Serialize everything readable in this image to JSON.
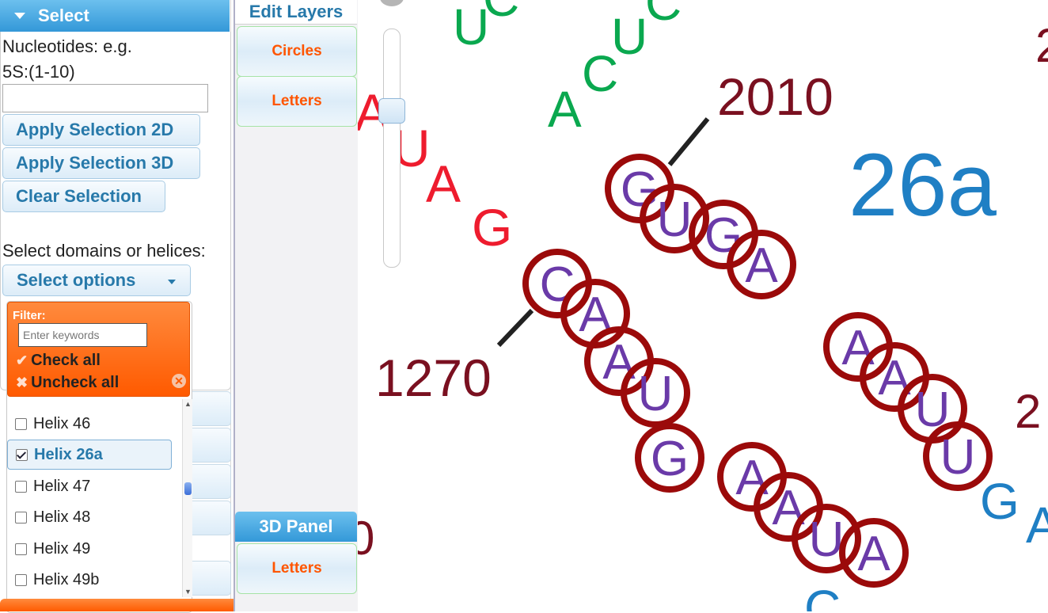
{
  "select_panel": {
    "title": "Select",
    "nucleotides_label_line1": "Nucleotides: e.g.",
    "nucleotides_label_line2": "5S:(1-10)",
    "nucleotides_value": "",
    "apply_2d": "Apply Selection 2D",
    "apply_3d": "Apply Selection 3D",
    "clear": "Clear Selection",
    "domains_label": "Select domains or helices:",
    "select_options": "Select options"
  },
  "dropdown": {
    "filter_label": "Filter:",
    "filter_placeholder": "Enter keywords",
    "check_all": "Check all",
    "uncheck_all": "Uncheck all",
    "options": [
      {
        "label": "Helix 46",
        "checked": false
      },
      {
        "label": "Helix 26a",
        "checked": true
      },
      {
        "label": "Helix 47",
        "checked": false
      },
      {
        "label": "Helix 48",
        "checked": false
      },
      {
        "label": "Helix 49",
        "checked": false
      },
      {
        "label": "Helix 49b",
        "checked": false
      }
    ]
  },
  "layers_panel": {
    "title": "Edit Layers",
    "circles": "Circles",
    "letters": "Letters",
    "panel_3d": "3D Panel",
    "letters_3d": "Letters"
  },
  "rna_canvas": {
    "helix_label": "26a",
    "number_labels": [
      "2010",
      "1270"
    ],
    "colors": {
      "green": "#0aa84f",
      "red": "#ee1c2e",
      "purple": "#6a3aa8",
      "circle": "#9b0a0a",
      "darkred": "#7a1020",
      "blue": "#1f7fc4"
    }
  }
}
